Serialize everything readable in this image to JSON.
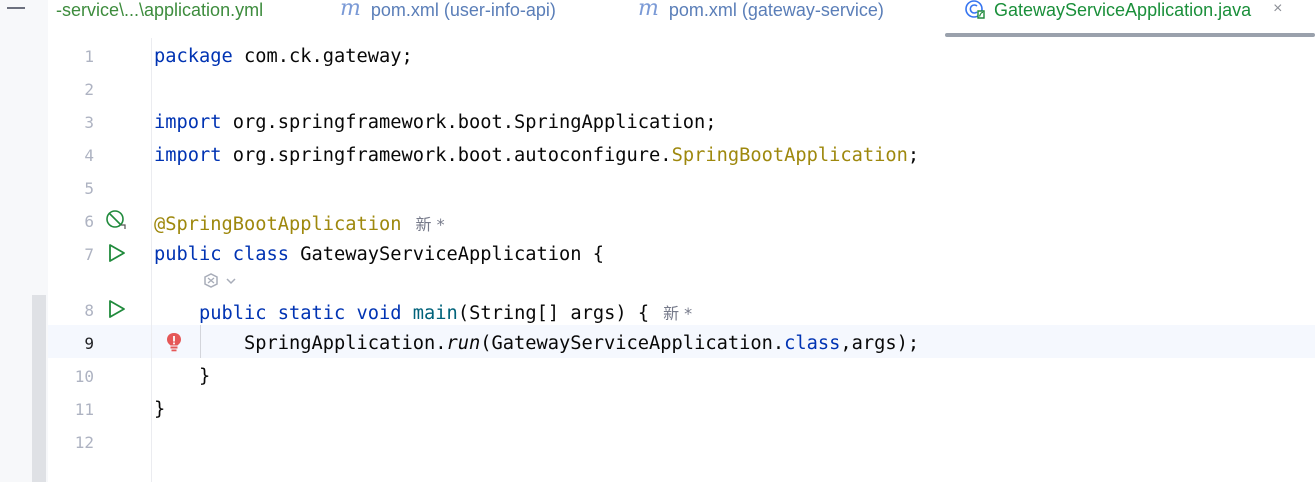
{
  "tabs": [
    {
      "label": "-service\\...\\application.yml",
      "icon": null
    },
    {
      "label": "pom.xml (user-info-api)",
      "icon": "maven-icon",
      "icon_glyph": "m"
    },
    {
      "label": "pom.xml (gateway-service)",
      "icon": "maven-icon",
      "icon_glyph": "m"
    },
    {
      "label": "GatewayServiceApplication.java",
      "icon": "spring-class-icon",
      "active": true
    }
  ],
  "close_glyph": "×",
  "editor": {
    "current_line": 9,
    "lines": [
      {
        "num": "1",
        "code": [
          {
            "t": "package",
            "c": "kw"
          },
          {
            "t": " com.ck.gateway;"
          }
        ]
      },
      {
        "num": "2",
        "code": []
      },
      {
        "num": "3",
        "code": [
          {
            "t": "import",
            "c": "kw"
          },
          {
            "t": " org.springframework.boot.SpringApplication;"
          }
        ]
      },
      {
        "num": "4",
        "code": [
          {
            "t": "import",
            "c": "kw"
          },
          {
            "t": " org.springframework.boot.autoconfigure."
          },
          {
            "t": "SpringBootApplication",
            "c": "ann"
          },
          {
            "t": ";"
          }
        ]
      },
      {
        "num": "5",
        "code": []
      },
      {
        "num": "6",
        "code": [
          {
            "t": "@SpringBootApplication",
            "c": "ann"
          }
        ],
        "hint": "新 *",
        "gutter_icon": "no-beans-icon"
      },
      {
        "num": "7",
        "code": [
          {
            "t": "public class",
            "c": "kw"
          },
          {
            "t": " GatewayServiceApplication {"
          }
        ],
        "gutter_icon": "run-icon"
      },
      {
        "num": "8",
        "code": [
          {
            "t": "    "
          },
          {
            "t": "public static void",
            "c": "kw"
          },
          {
            "t": " "
          },
          {
            "t": "main",
            "c": "fn"
          },
          {
            "t": "(String[] args) {"
          }
        ],
        "hint": "新 *",
        "gutter_icon": "run-icon"
      },
      {
        "num": "9",
        "code": [
          {
            "t": "        SpringApplication."
          },
          {
            "t": "run",
            "c": "it"
          },
          {
            "t": "(GatewayServiceApplication."
          },
          {
            "t": "class",
            "c": "kw"
          },
          {
            "t": ",args);"
          }
        ],
        "gutter_icon": "error-bulb-icon"
      },
      {
        "num": "10",
        "code": [
          {
            "t": "    }"
          }
        ]
      },
      {
        "num": "11",
        "code": [
          {
            "t": "}"
          }
        ]
      },
      {
        "num": "12",
        "code": []
      }
    ]
  },
  "colors": {
    "keyword": "#0033b3",
    "annotation": "#9e880d",
    "method": "#00627a",
    "run_icon": "#208a3c",
    "error": "#e55757",
    "active_tab": "#1a8f3a"
  }
}
